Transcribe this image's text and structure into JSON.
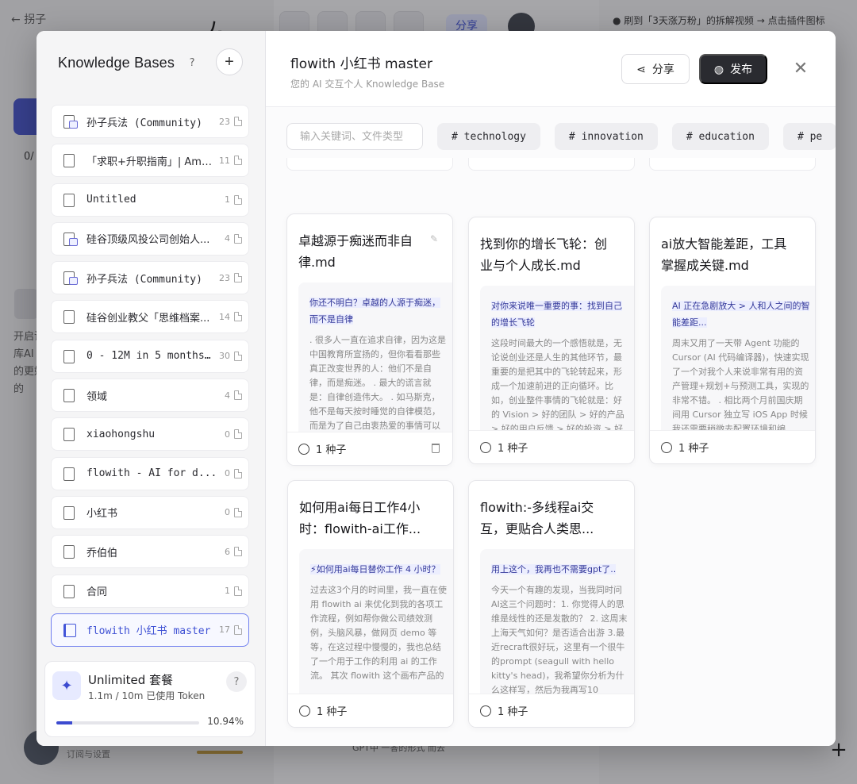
{
  "background": {
    "back_label": "拐子",
    "share_label": "分享",
    "hint_text": "● 刷到「3天涨万粉」的拆解视频 → 点击插件图标",
    "side_text_1": "0/",
    "side_text_2": "开启识库AI 的更好的",
    "user_text": "订阅与设置",
    "gpt_text": "GPT中 一答的形式 而去"
  },
  "sidebar": {
    "title": "Knowledge Bases",
    "help_glyph": "?",
    "add_glyph": "+",
    "items": [
      {
        "label": "孙子兵法 (Community)",
        "count": "23",
        "mono": true,
        "community": true
      },
      {
        "label": "「求职+升职指南」| Amazon...",
        "count": "11",
        "mono": false,
        "community": false
      },
      {
        "label": "Untitled",
        "count": "1",
        "mono": true,
        "community": false
      },
      {
        "label": "硅谷顶级风投公司创始人...",
        "count": "4",
        "mono": false,
        "community": true
      },
      {
        "label": "孙子兵法 (Community)",
        "count": "23",
        "mono": true,
        "community": true
      },
      {
        "label": "硅谷创业教父「思维档案...",
        "count": "14",
        "mono": false,
        "community": false
      },
      {
        "label": "0 - 12M in 5 months...",
        "count": "30",
        "mono": true,
        "community": false
      },
      {
        "label": "领域",
        "count": "4",
        "mono": false,
        "community": false
      },
      {
        "label": "xiaohongshu",
        "count": "0",
        "mono": true,
        "community": false
      },
      {
        "label": "flowith - AI for d...",
        "count": "0",
        "mono": true,
        "community": false
      },
      {
        "label": "小红书",
        "count": "0",
        "mono": false,
        "community": false
      },
      {
        "label": "乔伯伯",
        "count": "6",
        "mono": false,
        "community": false
      },
      {
        "label": "合同",
        "count": "1",
        "mono": false,
        "community": false
      },
      {
        "label": "flowith 小红书 master",
        "count": "17",
        "mono": true,
        "community": false,
        "active": true
      }
    ]
  },
  "plan": {
    "name": "Unlimited 套餐",
    "usage": "1.1m / 10m 已使用 Token",
    "percent_label": "10.94%",
    "percent": 10.94,
    "help_glyph": "?"
  },
  "main": {
    "title": "flowith 小红书 master",
    "subtitle": "您的 AI 交互个人 Knowledge Base",
    "share_label": "分享",
    "publish_label": "发布",
    "close_glyph": "✕",
    "search_placeholder": "输入关键词、文件类型",
    "tags": [
      "# technology",
      "# innovation",
      "# education",
      "# pe"
    ],
    "cards": [
      {
        "title": "卓越源于痴迷而非自律.md",
        "highlight": "你还不明白？卓越的人源于痴迷，而不是自律",
        "text": ". 很多人一直在追求自律，因为这是中国教育所宣扬的，但你看看那些真正改变世界的人：他们不是自律，而是痴迷。 . 最大的谎言就是：自律创造伟大。 . 如马斯克，他不是每天按时睡觉的自律模范，而是为了自己由衷热爱的事情可以",
        "seed": "1 种子"
      },
      {
        "title": "找到你的增长飞轮：创业与个人成长.md",
        "highlight": "对你来说唯一重要的事：找到自己的增长飞轮",
        "text": "这段时间最大的一个感悟就是，无论说创业还是人生的其他环节，最重要的是把其中的飞轮转起来，形成一个加速前进的正向循环。比如，创业整件事情的飞轮就是：好的 Vision > 好的团队 > 好的产品 > 好的用户反馈 > 好的投资 > 好",
        "seed": "1 种子"
      },
      {
        "title": "ai放大智能差距，工具掌握成关键.md",
        "highlight": "AI 正在急剧放大 > 人和人之间的智能差距...",
        "text": "周末又用了一天带 Agent 功能的 Cursor (AI 代码编译器)，快速实现了一个对我个人来说非常有用的资产管理+规划+与预测工具，实现的非常不错。 . 相比两个月前国庆期间用 Cursor 独立写 iOS App 时候我还需要稍微去配置环境和编",
        "seed": "1 种子"
      },
      {
        "title": "如何用ai每日工作4小时：flowith-ai工作...",
        "highlight": "⚡如何用ai每日替你工作 4 小时？",
        "text": "过去这3个月的时间里，我一直在使用 flowith ai 来优化到我的各项工作流程，例如帮你做公司绩效测例，头脑风暴，做网页 demo 等等，在这过程中慢慢的，我也总结了一个用于工作的利用 ai 的工作流。 其次 flowith 这个画布产品的",
        "seed": "1 种子"
      },
      {
        "title": "flowith:-多线程ai交互，更贴合人类思...",
        "highlight": "用上这个，我再也不需要gpt了..",
        "text": "今天一个有趣的发现，当我同时问AI这三个问题时：1. 你觉得人的思维是线性的还是发散的？ 2. 这周末上海天气如何？是否适合出游 3.最近recraft很好玩，这里有一个很牛的prompt (seagull with hello kitty's head)，我希望你分析为什么这样写，然后为我再写10",
        "seed": "1 种子"
      }
    ]
  }
}
